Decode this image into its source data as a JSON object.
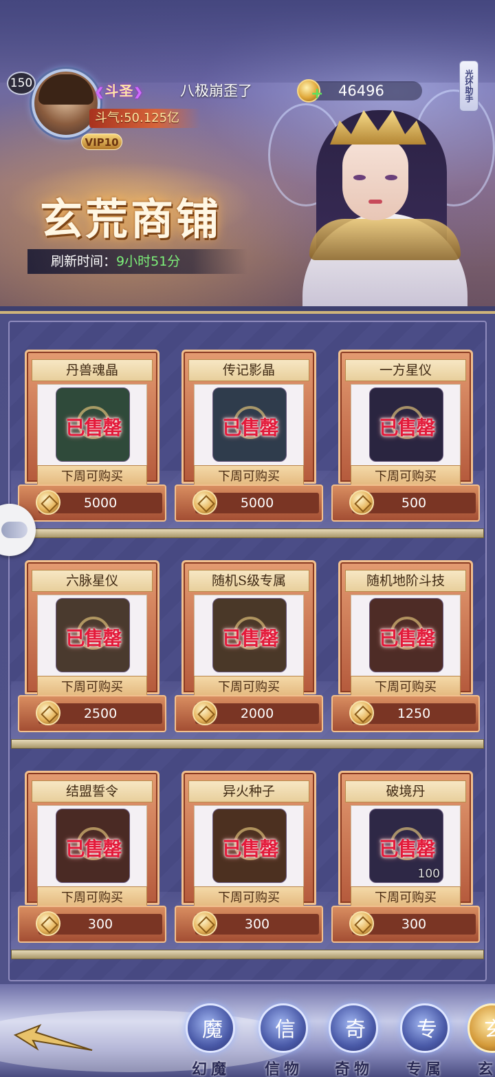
{
  "header": {
    "level": "150",
    "rank_title": "斗圣",
    "player_name": "八极崩歪了",
    "power": "斗气:50.125亿",
    "vip": "VIP10",
    "currency_value": "46496",
    "helper_tab": "光环助手",
    "shop_title": "玄荒商铺",
    "refresh_label": "刷新时间：",
    "refresh_value": "9小时51分"
  },
  "shop": {
    "items": [
      {
        "name": "丹兽魂晶",
        "status": "已售罄",
        "note": "下周可购买",
        "price": "5000",
        "icon": "soul-crystal-icon",
        "color": "#2f4a3a"
      },
      {
        "name": "传记影晶",
        "status": "已售罄",
        "note": "下周可购买",
        "price": "5000",
        "icon": "biography-crystal-icon",
        "color": "#2f3c4c"
      },
      {
        "name": "一方星仪",
        "status": "已售罄",
        "note": "下周可购买",
        "price": "500",
        "icon": "star-instrument-icon",
        "color": "#2a2540"
      },
      {
        "name": "六脉星仪",
        "status": "已售罄",
        "note": "下周可购买",
        "price": "2500",
        "icon": "six-vein-instrument-icon",
        "color": "#4a3a2e"
      },
      {
        "name": "随机S级专属",
        "status": "已售罄",
        "note": "下周可购买",
        "price": "2000",
        "icon": "s-rank-exclusive-icon",
        "color": "#4a3828"
      },
      {
        "name": "随机地阶斗技",
        "status": "已售罄",
        "note": "下周可购买",
        "price": "1250",
        "icon": "earth-skill-scroll-icon",
        "color": "#4e2c26"
      },
      {
        "name": "结盟誓令",
        "status": "已售罄",
        "note": "下周可购买",
        "price": "300",
        "icon": "alliance-token-icon",
        "color": "#4a2a24"
      },
      {
        "name": "异火种子",
        "status": "已售罄",
        "note": "下周可购买",
        "price": "300",
        "icon": "fire-seed-icon",
        "color": "#4c3020"
      },
      {
        "name": "破境丹",
        "status": "已售罄",
        "note": "下周可购买",
        "price": "300",
        "icon": "breakthrough-pill-icon",
        "color": "#2e2846",
        "qty": "100"
      }
    ]
  },
  "nav": {
    "items": [
      {
        "label": "幻魔",
        "glyph": "魔"
      },
      {
        "label": "信物",
        "glyph": "信"
      },
      {
        "label": "奇物",
        "glyph": "奇"
      },
      {
        "label": "专属",
        "glyph": "专"
      },
      {
        "label": "玄",
        "glyph": "玄"
      }
    ]
  },
  "colors": {
    "accent_gold": "#f2c08e",
    "sold_out_red": "#e31a3a",
    "refresh_green": "#7df27a"
  }
}
